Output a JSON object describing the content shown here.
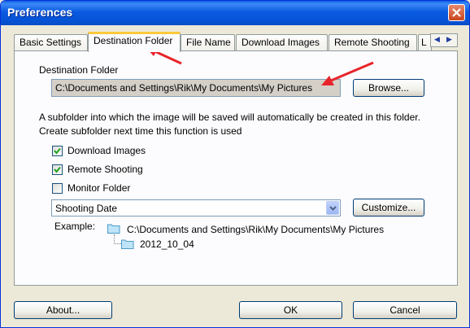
{
  "window": {
    "title": "Preferences"
  },
  "tabs": [
    {
      "label": "Basic Settings"
    },
    {
      "label": "Destination Folder"
    },
    {
      "label": "File Name"
    },
    {
      "label": "Download Images"
    },
    {
      "label": "Remote Shooting"
    },
    {
      "label": "L"
    }
  ],
  "destination": {
    "heading": "Destination Folder",
    "path": "C:\\Documents and Settings\\Rik\\My Documents\\My Pictures",
    "browse_label": "Browse..."
  },
  "description": {
    "line1": "A subfolder into which the image will be saved will automatically be created in this folder.",
    "line2": "Create subfolder next time this function is used"
  },
  "options": [
    {
      "label": "Download Images",
      "checked": true
    },
    {
      "label": "Remote Shooting",
      "checked": true
    },
    {
      "label": "Monitor Folder",
      "checked": false
    }
  ],
  "subfolder": {
    "selected": "Shooting Date",
    "customize_label": "Customize..."
  },
  "example": {
    "label": "Example:",
    "root_path": "C:\\Documents and Settings\\Rik\\My Documents\\My Pictures",
    "subfolder_name": "2012_10_04"
  },
  "footer": {
    "about_label": "About...",
    "ok_label": "OK",
    "cancel_label": "Cancel"
  },
  "colors": {
    "accent_tab": "#ffc83c",
    "annotation_arrow": "#e8242b",
    "titlebar": "#0a5ee3"
  }
}
